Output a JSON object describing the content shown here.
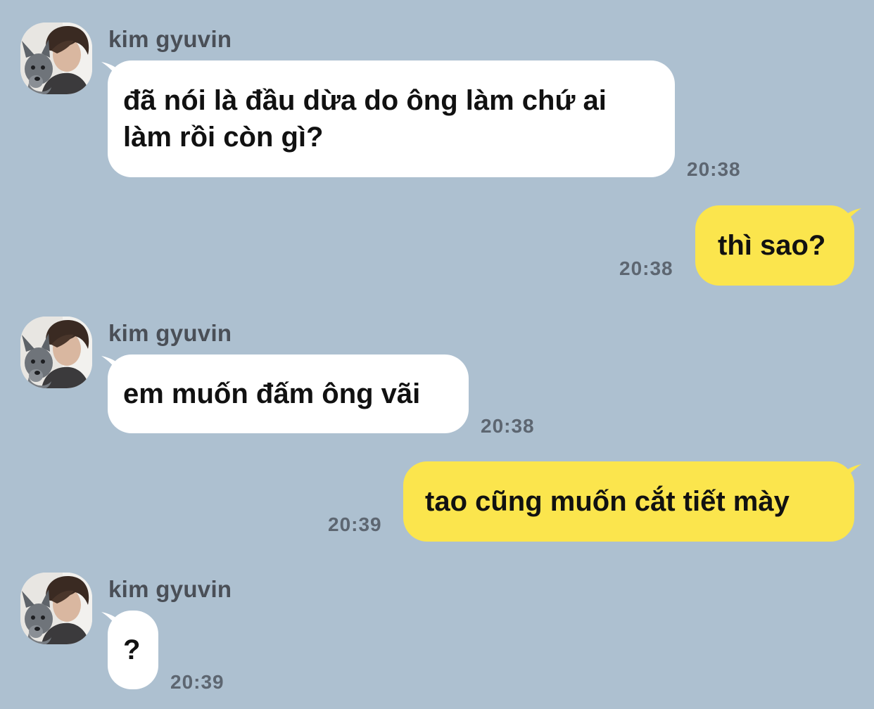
{
  "colors": {
    "background": "#adc0d0",
    "incoming_bubble": "#ffffff",
    "outgoing_bubble": "#fbe54d",
    "sender_name": "#4a4f57",
    "timestamp": "#5d6671"
  },
  "messages": [
    {
      "direction": "incoming",
      "sender": "kim gyuvin",
      "avatar_icon": "profile-photo-with-dog",
      "line1": "đã nói là đầu dừa do ông làm chứ ai",
      "line2": "làm rồi còn gì?",
      "time": "20:38"
    },
    {
      "direction": "outgoing",
      "text": "thì sao?",
      "time": "20:38"
    },
    {
      "direction": "incoming",
      "sender": "kim gyuvin",
      "avatar_icon": "profile-photo-with-dog",
      "text": "em muốn đấm ông vãi",
      "time": "20:38"
    },
    {
      "direction": "outgoing",
      "text": "tao cũng muốn cắt tiết mày",
      "time": "20:39"
    },
    {
      "direction": "incoming",
      "sender": "kim gyuvin",
      "avatar_icon": "profile-photo-with-dog",
      "text": "?",
      "time": "20:39"
    }
  ]
}
